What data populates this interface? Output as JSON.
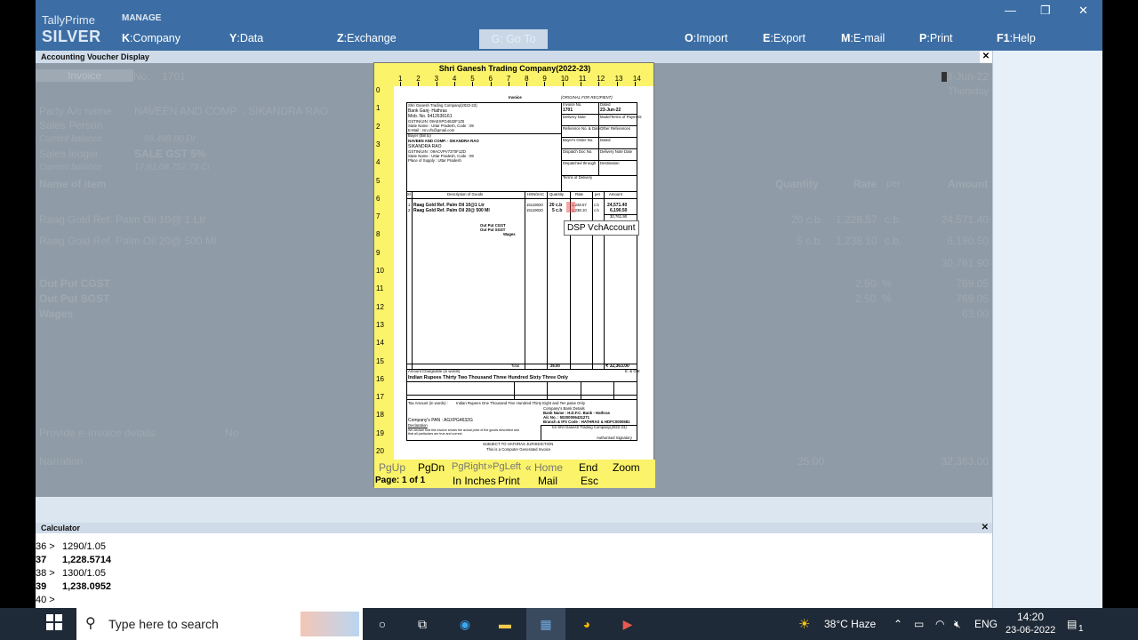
{
  "app": {
    "brand_line1": "TallyPrime",
    "brand_line2": "SILVER",
    "manage_label": "MANAGE",
    "menu": [
      {
        "key": "K",
        "label": ":Company"
      },
      {
        "key": "Y",
        "label": ":Data"
      },
      {
        "key": "Z",
        "label": ":Exchange"
      },
      {
        "key": "G",
        "label": ": Go To"
      },
      {
        "key": "O",
        "label": ":Import"
      },
      {
        "key": "E",
        "label": ":Export"
      },
      {
        "key": "M",
        "label": ":E-mail"
      },
      {
        "key": "P",
        "label": ":Print"
      },
      {
        "key": "F1",
        "label": ":Help"
      }
    ],
    "window_controls": [
      "—",
      "❐",
      "✕"
    ]
  },
  "voucher_display": {
    "panel_title": "Accounting Voucher Display",
    "voucher_type": "Invoice",
    "no_label": "No.",
    "no_value": "1701",
    "date": "3-Jun-22",
    "day": "Thursday",
    "party_label": "Party A/c name",
    "party_value": "NAVEEN AND COMP. - SIKANDRA RAO",
    "sales_person_label": "Sales Person",
    "current_balance_label": "Current balance",
    "current_balance_value": "69,488.00 Dr",
    "sales_ledger_label": "Sales ledger",
    "sales_ledger_value": "SALE  GST 5%",
    "current_balance2_label": "Current balance",
    "current_balance2_value": "17,81,08,752.73 Cr",
    "headers": {
      "item": "Name of item",
      "qty": "Quantity",
      "rate": "Rate",
      "per": "per",
      "amount": "Amount"
    },
    "items": [
      {
        "name": "Raag Gold Ref. Palm Oil 10@ 1 Ltr",
        "qty": "20 c.b.",
        "rate": "1,228.57",
        "per": "c.b.",
        "amount": "24,571.40"
      },
      {
        "name": "Raag Gold Ref. Palm Oil 20@ 500 Ml",
        "qty": "5 c.b.",
        "rate": "1,238.10",
        "per": "c.b.",
        "amount": "6,190.50"
      }
    ],
    "subtotal": "30,761.90",
    "taxes": [
      {
        "name": "Out Put CGST",
        "rate": "2.50",
        "unit": "%",
        "amount": "769.05"
      },
      {
        "name": "Out Put SGST",
        "rate": "2.50",
        "unit": "%",
        "amount": "769.05"
      },
      {
        "name": "Wages",
        "rate": "",
        "unit": "",
        "amount": "63.00"
      }
    ],
    "einvoice_label": "Provide e-Invoice details",
    "einvoice_value": "No",
    "narration_label": "Narration",
    "total_qty": "25.00",
    "total_amount": "32,363.00"
  },
  "preview": {
    "title": "Shri Ganesh Trading Company(2022-23)",
    "ruler_top": [
      "1",
      "2",
      "3",
      "4",
      "5",
      "6",
      "7",
      "8",
      "9",
      "10",
      "11",
      "12",
      "13",
      "14"
    ],
    "ruler_left": [
      "0",
      "1",
      "2",
      "3",
      "4",
      "5",
      "6",
      "7",
      "8",
      "9",
      "10",
      "11",
      "12",
      "13",
      "14",
      "15",
      "16",
      "17",
      "18",
      "19",
      "20"
    ],
    "tooltip": "DSP VchAccount",
    "footer_row1": [
      "PgUp",
      "PgDn",
      "PgRight",
      "»PgLeft",
      "« Home",
      "End",
      "Zoom"
    ],
    "footer_row2": [
      "Page: 1 of 1",
      "In Inches",
      "Print",
      "Mail",
      "Esc"
    ],
    "invoice": {
      "heading": "Invoice",
      "original": "(ORIGINAL FOR RECIPIENT)",
      "seller": [
        "Shri Ganesh Trading Company(2022-23)",
        "Bank Ganj- Hathras",
        "Mob. No. 9412636161",
        "GSTIN/UIN: 09AEXPG4632F1Z5",
        "State Name : Uttar Pradesh, Code : 09",
        "E-Mail : rsn.cfs@gmail.com"
      ],
      "buyer_label": "Buyer (Bill to)",
      "buyer": [
        "NAVEEN AND COMP. - SIKANDRA RAO",
        "SIKANDRA RAO",
        "GSTIN/UIN : 09ACVPV7370F1ZD",
        "State Name : Uttar Pradesh, Code : 09",
        "Place of Supply : Uttar Pradesh"
      ],
      "meta": [
        [
          "Invoice No.",
          "Dated"
        ],
        [
          "1701",
          "23-Jun-22"
        ],
        [
          "Delivery Note",
          "Mode/Terms of Payment"
        ],
        [
          "Reference No. & Date",
          "Other References"
        ],
        [
          "Buyer's Order No.",
          "Dated"
        ],
        [
          "Dispatch Doc No.",
          "Delivery Note Date"
        ],
        [
          "Dispatched through",
          "Destination"
        ],
        [
          "Terms of Delivery",
          ""
        ]
      ],
      "cols": [
        "Sl",
        "Description of Goods",
        "HSN/SAC",
        "Quantity",
        "Rate",
        "per",
        "Amount"
      ],
      "lines": [
        {
          "sl": "1",
          "desc": "Raag Gold Ref. Palm Oil 10@1 Ltr",
          "hsn": "15119020",
          "qty": "20 c.b",
          "rate": "1,228.57",
          "per": "c.b",
          "amt": "24,571.40"
        },
        {
          "sl": "2",
          "desc": "Raag Gold Ref. Palm Oil 20@ 500 Ml",
          "hsn": "15119020",
          "qty": "5 c.b",
          "rate": "1,238.10",
          "per": "c.b",
          "amt": "6,190.50"
        }
      ],
      "sub": "30,761.90",
      "tax_lines": [
        "Out Put CGST",
        "Out Put SGST",
        "Wages"
      ],
      "tax_amts": [
        "769.05",
        "769.05",
        "63.00"
      ],
      "total_label": "Total",
      "total_qty": "25.00",
      "total_amt": "₹ 32,363.00",
      "words_label": "Amount Chargeable (in words)",
      "eoe": "E. & O.E",
      "words": "Indian Rupees Thirty Two Thousand Three Hundred Sixty Three Only",
      "tax_words_label": "Tax Amount (in words) :",
      "tax_words": "Indian Rupees One Thousand Five Hundred Thirty Eight and Ten paise Only",
      "bank_title": "Company's Bank Details",
      "bank": [
        "Bank Name : H.D.F.C. Bank - Hathras",
        "A/c No. : 50200006431271",
        "Branch & IFS Code : HATHRAS & HDFC0000581"
      ],
      "pan": "Company's PAN   : AGXPG4632G",
      "declaration": "Declaration",
      "declaration_text": "We declare that this invoice shows the actual price of the goods described and that all particulars are true and correct.",
      "for_company": "for Shri Ganesh Trading Company(2022-23)",
      "signatory": "Authorised Signatory",
      "jurisdiction": "SUBJECT TO HATHRAS JURISDICTION",
      "computer_generated": "This is a Computer Generated Invoice"
    }
  },
  "calculator": {
    "title": "Calculator",
    "lines": [
      {
        "n": "36 >",
        "v": "1290/1.05",
        "bold": false
      },
      {
        "n": "37",
        "v": "1,228.5714",
        "bold": true
      },
      {
        "n": "38 >",
        "v": "1300/1.05",
        "bold": false
      },
      {
        "n": "39",
        "v": "1,238.0952",
        "bold": true
      },
      {
        "n": "40 >",
        "v": "",
        "bold": false
      }
    ]
  },
  "taskbar": {
    "search_placeholder": "Type here to search",
    "weather": "38°C  Haze",
    "lang": "ENG",
    "time": "14:20",
    "date": "23-06-2022",
    "notif": "1"
  }
}
